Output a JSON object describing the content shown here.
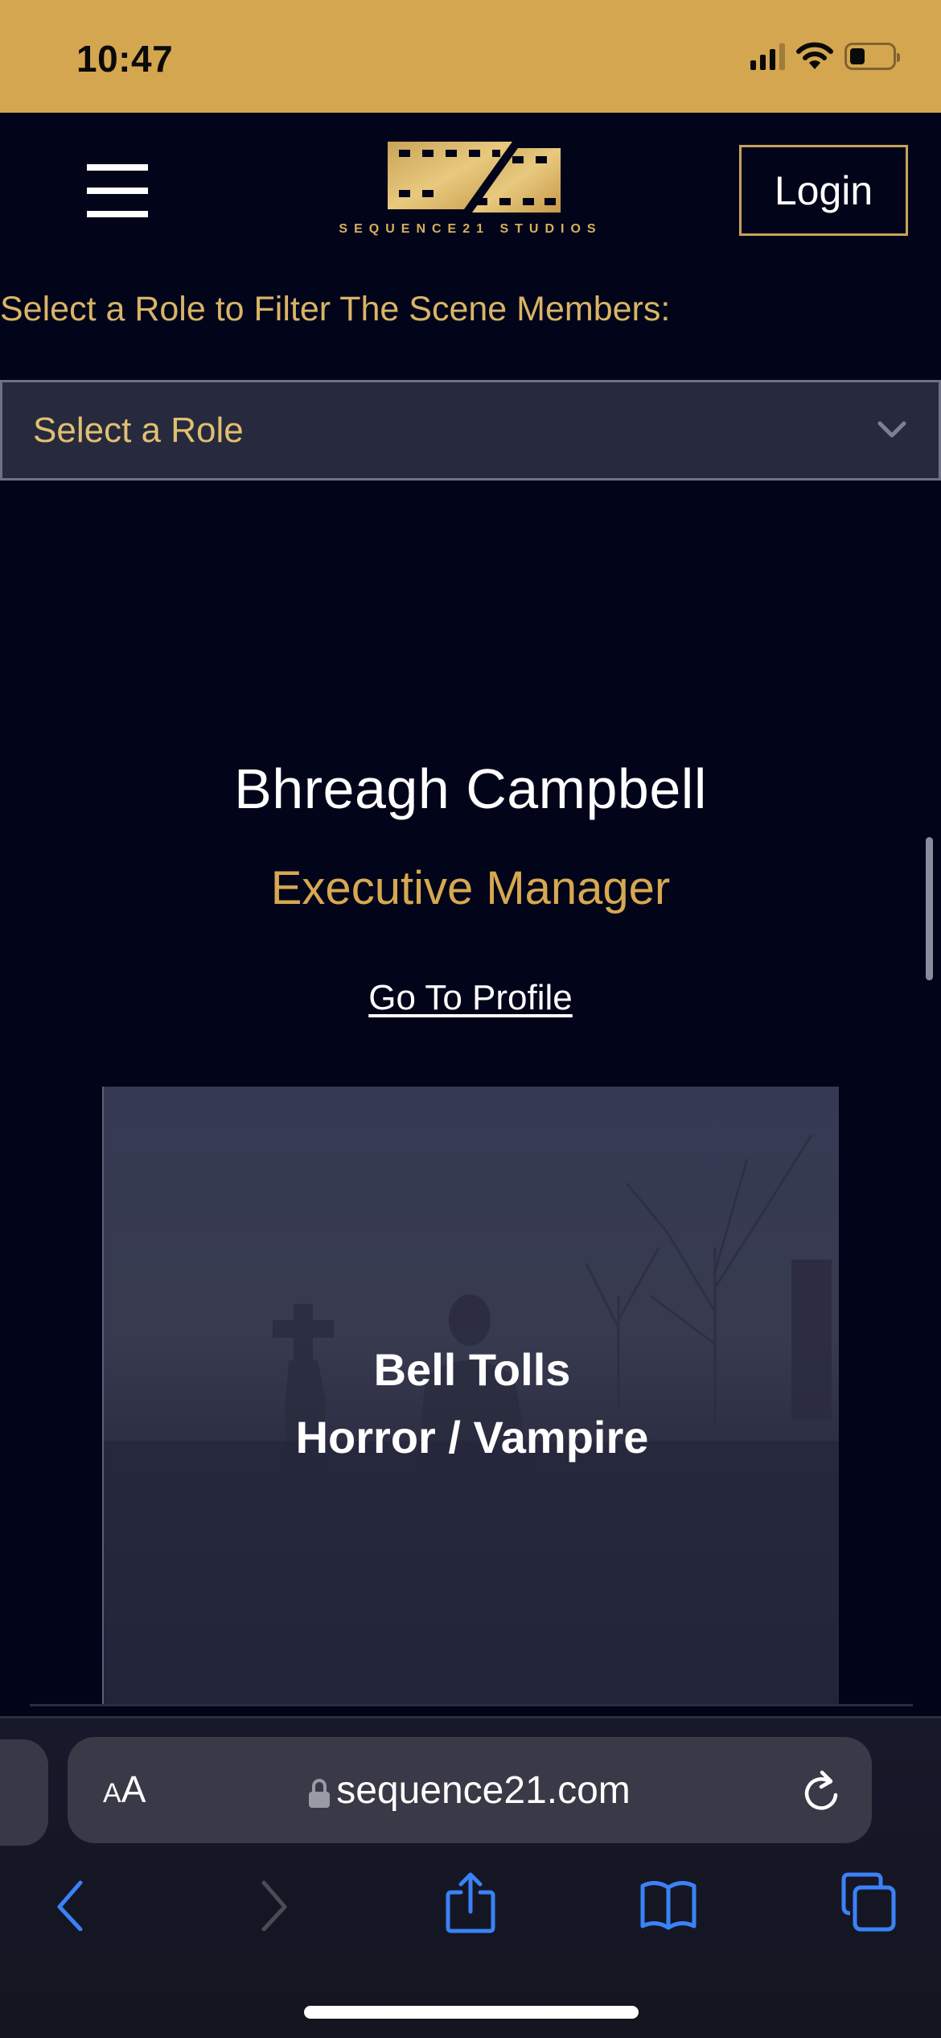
{
  "status_bar": {
    "time": "10:47",
    "signal_bars": 3,
    "signal_bars_total": 4,
    "battery_level": 0.3
  },
  "header": {
    "logo_text": "SEQUENCE21 STUDIOS",
    "menu_icon": "hamburger-menu-icon",
    "login_label": "Login"
  },
  "filter": {
    "label": "Select a Role to Filter The Scene Members:",
    "select_value": "Select a Role"
  },
  "member": {
    "name": "Bhreagh Campbell",
    "role": "Executive Manager",
    "profile_link": "Go To Profile"
  },
  "scene": {
    "title": "Bell Tolls",
    "genre": "Horror / Vampire"
  },
  "browser": {
    "text_size_label_small": "A",
    "text_size_label_large": "A",
    "url": "sequence21.com",
    "toolbar": [
      "back",
      "forward",
      "share",
      "bookmarks",
      "tabs"
    ]
  },
  "colors": {
    "status_bar": "#d4a64f",
    "page_bg": "#02051a",
    "gold_text": "#d9b466",
    "role_gold": "#d7a851",
    "select_bg": "#272a3d",
    "safari_blue": "#3a82f7"
  }
}
